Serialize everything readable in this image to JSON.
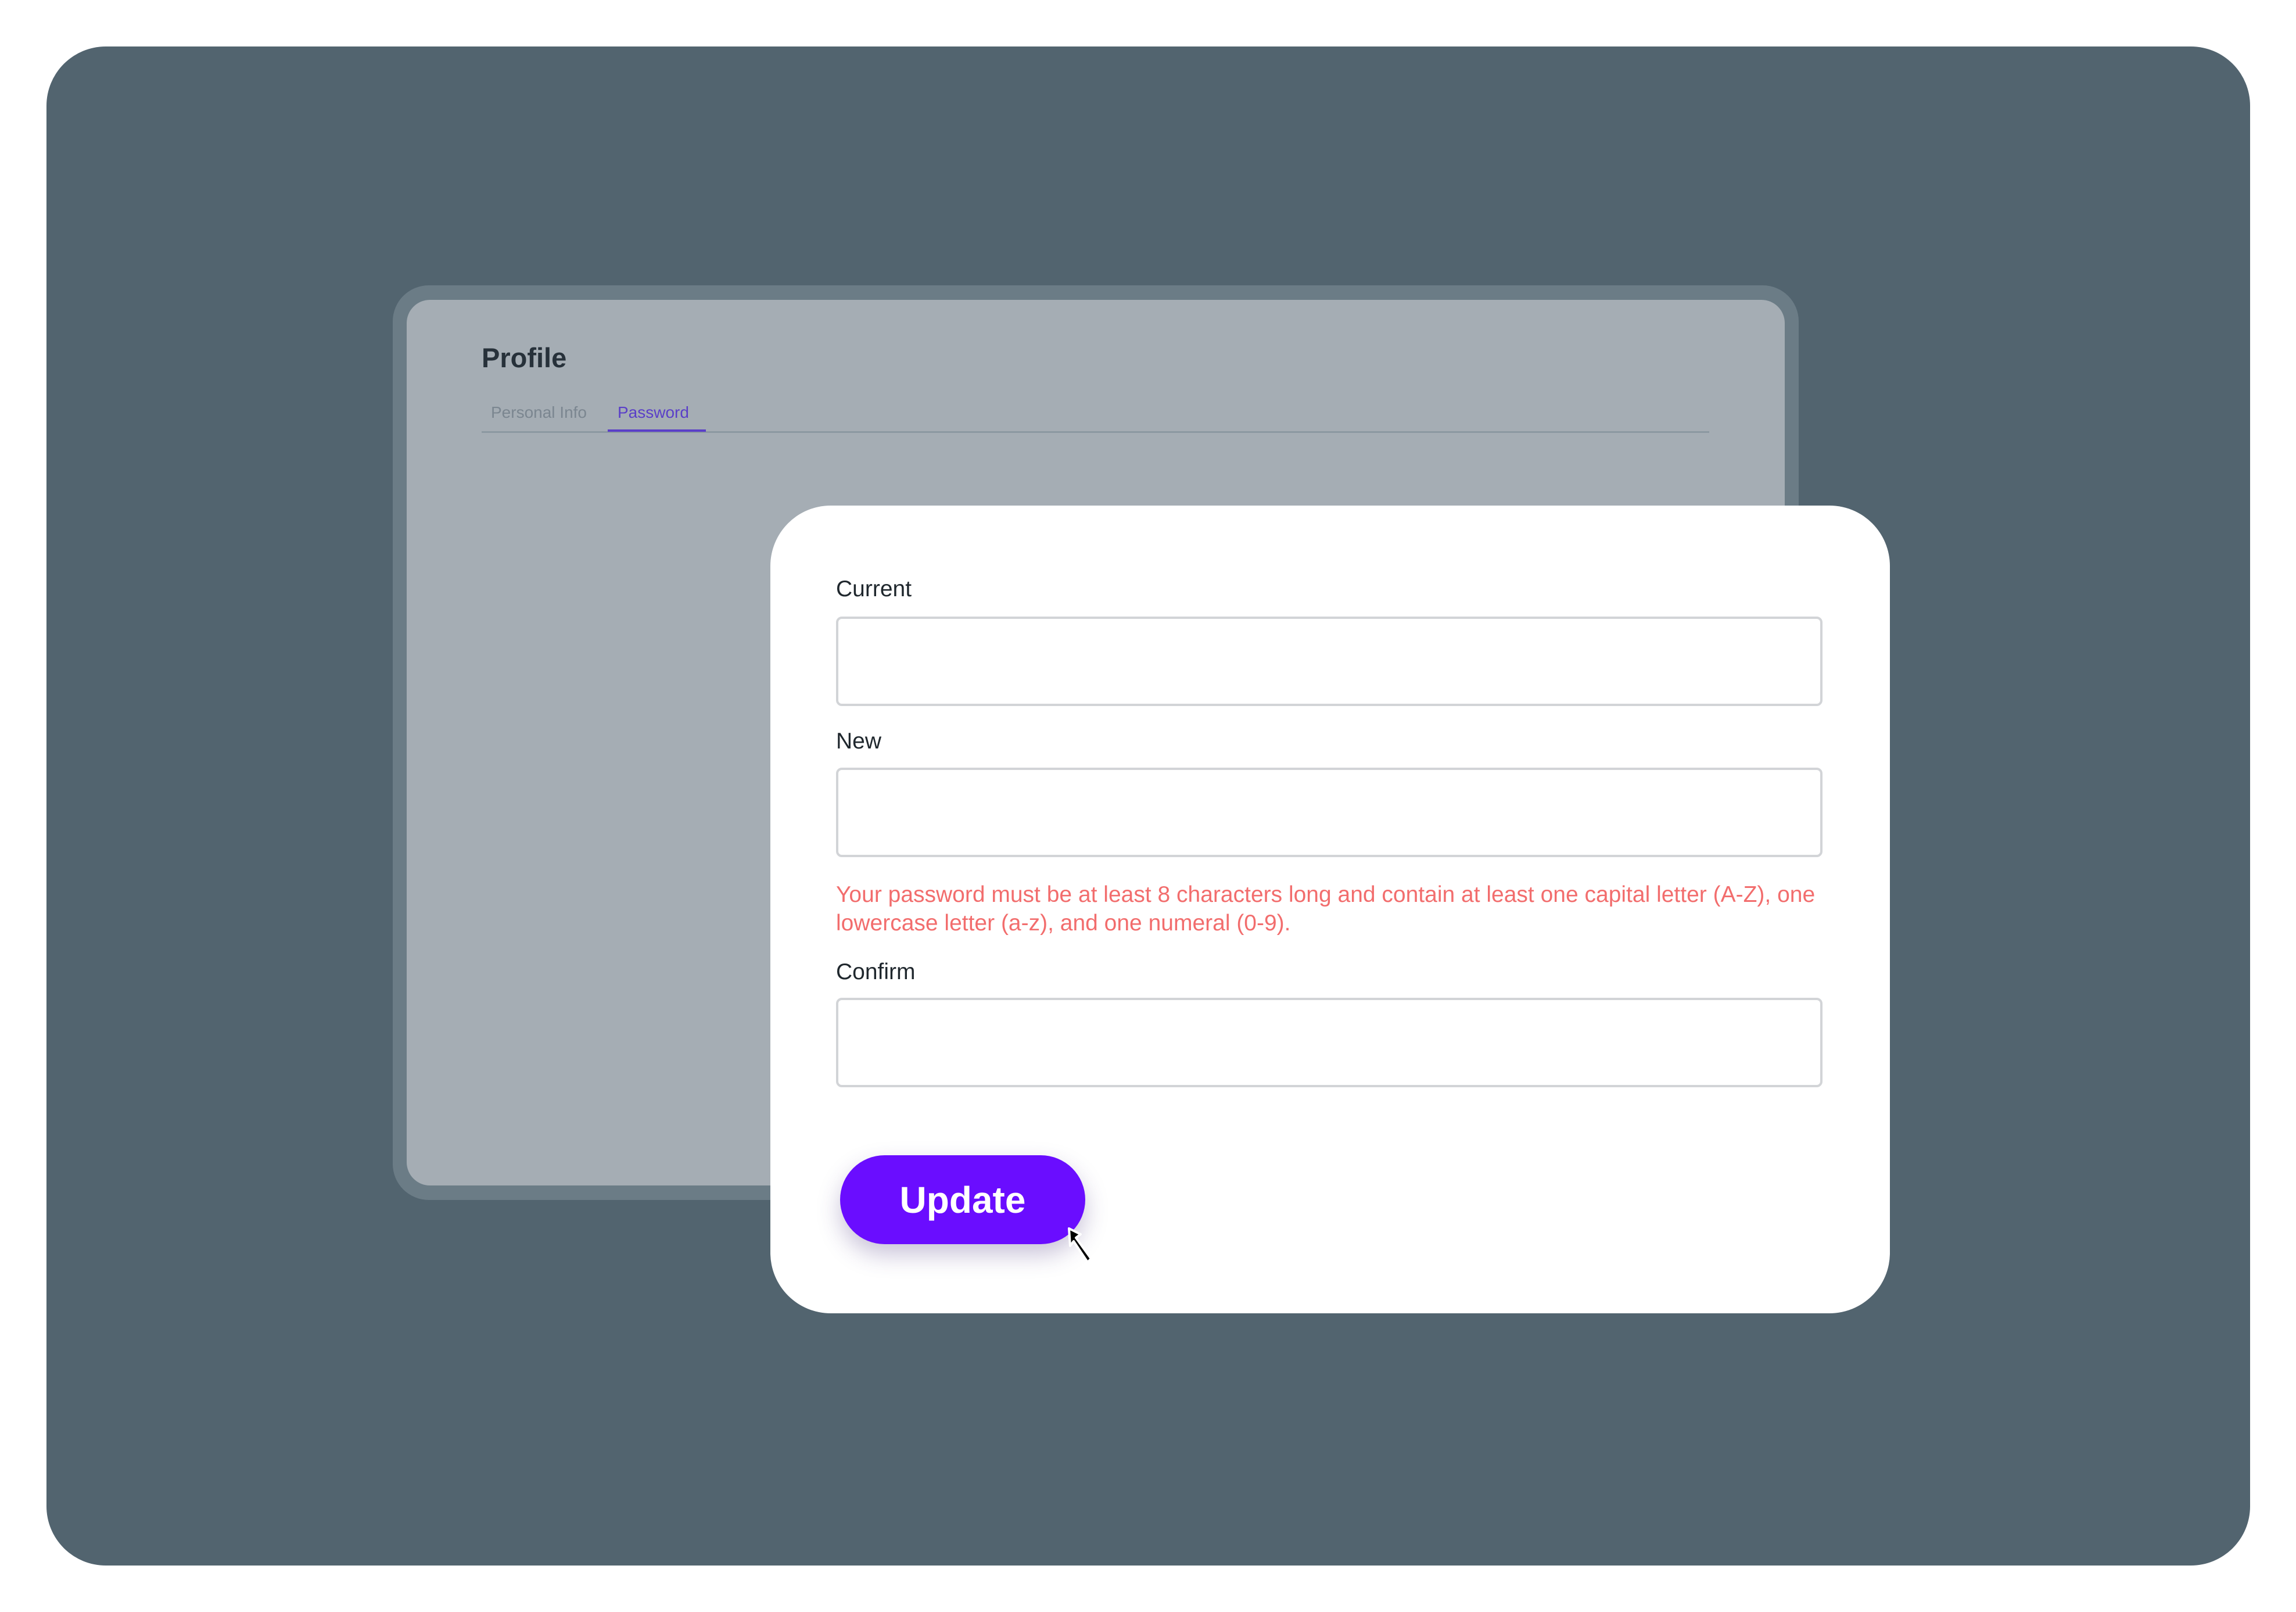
{
  "background_window": {
    "title": "Profile",
    "tabs": [
      {
        "label": "Personal Info",
        "active": false
      },
      {
        "label": "Password",
        "active": true
      }
    ]
  },
  "form": {
    "current": {
      "label": "Current",
      "value": ""
    },
    "new": {
      "label": "New",
      "value": ""
    },
    "error_message": "Your password must be at least 8 characters long and contain at least one capital letter (A-Z), one lowercase letter (a-z), and one numeral (0-9).",
    "confirm": {
      "label": "Confirm",
      "value": ""
    },
    "update_label": "Update"
  },
  "icons": {
    "cursor": "pointer-cursor-icon"
  },
  "colors": {
    "accent": "#6a0dff",
    "tab_active": "#5a3fc8",
    "error": "#f26d6d",
    "backdrop": "#52646f"
  }
}
